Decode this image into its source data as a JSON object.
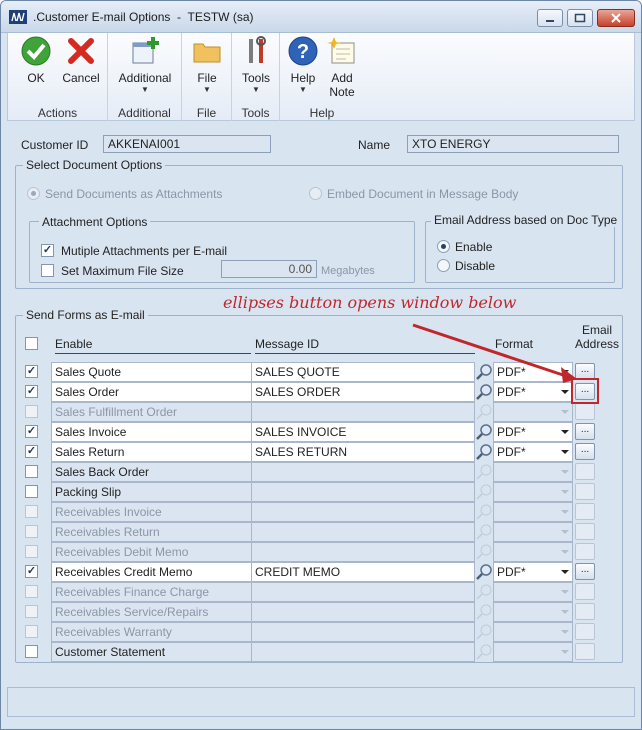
{
  "window": {
    "title": ".Customer E-mail Options  -  TESTW (sa)"
  },
  "ribbon": {
    "groups": [
      {
        "label": "Actions",
        "buttons": [
          {
            "label": "OK",
            "icon": "checkmark-icon"
          },
          {
            "label": "Cancel",
            "icon": "x-icon"
          }
        ]
      },
      {
        "label": "Additional",
        "buttons": [
          {
            "label": "Additional",
            "icon": "add-window-icon"
          }
        ]
      },
      {
        "label": "File",
        "buttons": [
          {
            "label": "File",
            "icon": "folder-icon"
          }
        ]
      },
      {
        "label": "Tools",
        "buttons": [
          {
            "label": "Tools",
            "icon": "tools-icon"
          }
        ]
      },
      {
        "label": "Help",
        "buttons": [
          {
            "label": "Help",
            "icon": "help-icon"
          },
          {
            "label": "Add\nNote",
            "icon": "note-icon"
          }
        ]
      }
    ]
  },
  "customer": {
    "id_label": "Customer ID",
    "id_value": "AKKENAI001",
    "name_label": "Name",
    "name_value": "XTO ENERGY"
  },
  "doc_options": {
    "title": "Select Document Options",
    "send_attachments": "Send Documents as Attachments",
    "embed_body": "Embed Document in Message Body",
    "attachment_options": {
      "title": "Attachment Options",
      "multiple": "Mutiple Attachments per E-mail",
      "max_size": "Set Maximum File Size",
      "size_value": "0.00",
      "units": "Megabytes"
    },
    "email_by_doc": {
      "title": "Email Address based on Doc Type",
      "enable": "Enable",
      "disable": "Disable"
    }
  },
  "forms": {
    "title": "Send Forms as E-mail",
    "headers": {
      "enable": "Enable",
      "message_id": "Message ID",
      "format": "Format",
      "email": "Email\nAddress"
    },
    "ellipsis": "...",
    "rows": [
      {
        "name": "Sales Quote",
        "checked": true,
        "enabled": true,
        "message_id": "SALES QUOTE",
        "format": "PDF*"
      },
      {
        "name": "Sales Order",
        "checked": true,
        "enabled": true,
        "message_id": "SALES ORDER",
        "format": "PDF*"
      },
      {
        "name": "Sales Fulfillment Order",
        "checked": false,
        "enabled": false,
        "message_id": "",
        "format": ""
      },
      {
        "name": "Sales Invoice",
        "checked": true,
        "enabled": true,
        "message_id": "SALES INVOICE",
        "format": "PDF*"
      },
      {
        "name": "Sales Return",
        "checked": true,
        "enabled": true,
        "message_id": "SALES RETURN",
        "format": "PDF*"
      },
      {
        "name": "Sales Back Order",
        "checked": false,
        "enabled": true,
        "message_id": "",
        "format": ""
      },
      {
        "name": "Packing Slip",
        "checked": false,
        "enabled": true,
        "message_id": "",
        "format": ""
      },
      {
        "name": "Receivables Invoice",
        "checked": false,
        "enabled": false,
        "message_id": "",
        "format": ""
      },
      {
        "name": "Receivables Return",
        "checked": false,
        "enabled": false,
        "message_id": "",
        "format": ""
      },
      {
        "name": "Receivables Debit Memo",
        "checked": false,
        "enabled": false,
        "message_id": "",
        "format": ""
      },
      {
        "name": "Receivables Credit Memo",
        "checked": true,
        "enabled": true,
        "message_id": "CREDIT MEMO",
        "format": "PDF*"
      },
      {
        "name": "Receivables Finance Charge",
        "checked": false,
        "enabled": false,
        "message_id": "",
        "format": ""
      },
      {
        "name": "Receivables Service/Repairs",
        "checked": false,
        "enabled": false,
        "message_id": "",
        "format": ""
      },
      {
        "name": "Receivables Warranty",
        "checked": false,
        "enabled": false,
        "message_id": "",
        "format": ""
      },
      {
        "name": "Customer Statement",
        "checked": false,
        "enabled": true,
        "message_id": "",
        "format": ""
      }
    ]
  },
  "annotation": {
    "text": "ellipses button opens window below",
    "color": "#c0272d"
  }
}
